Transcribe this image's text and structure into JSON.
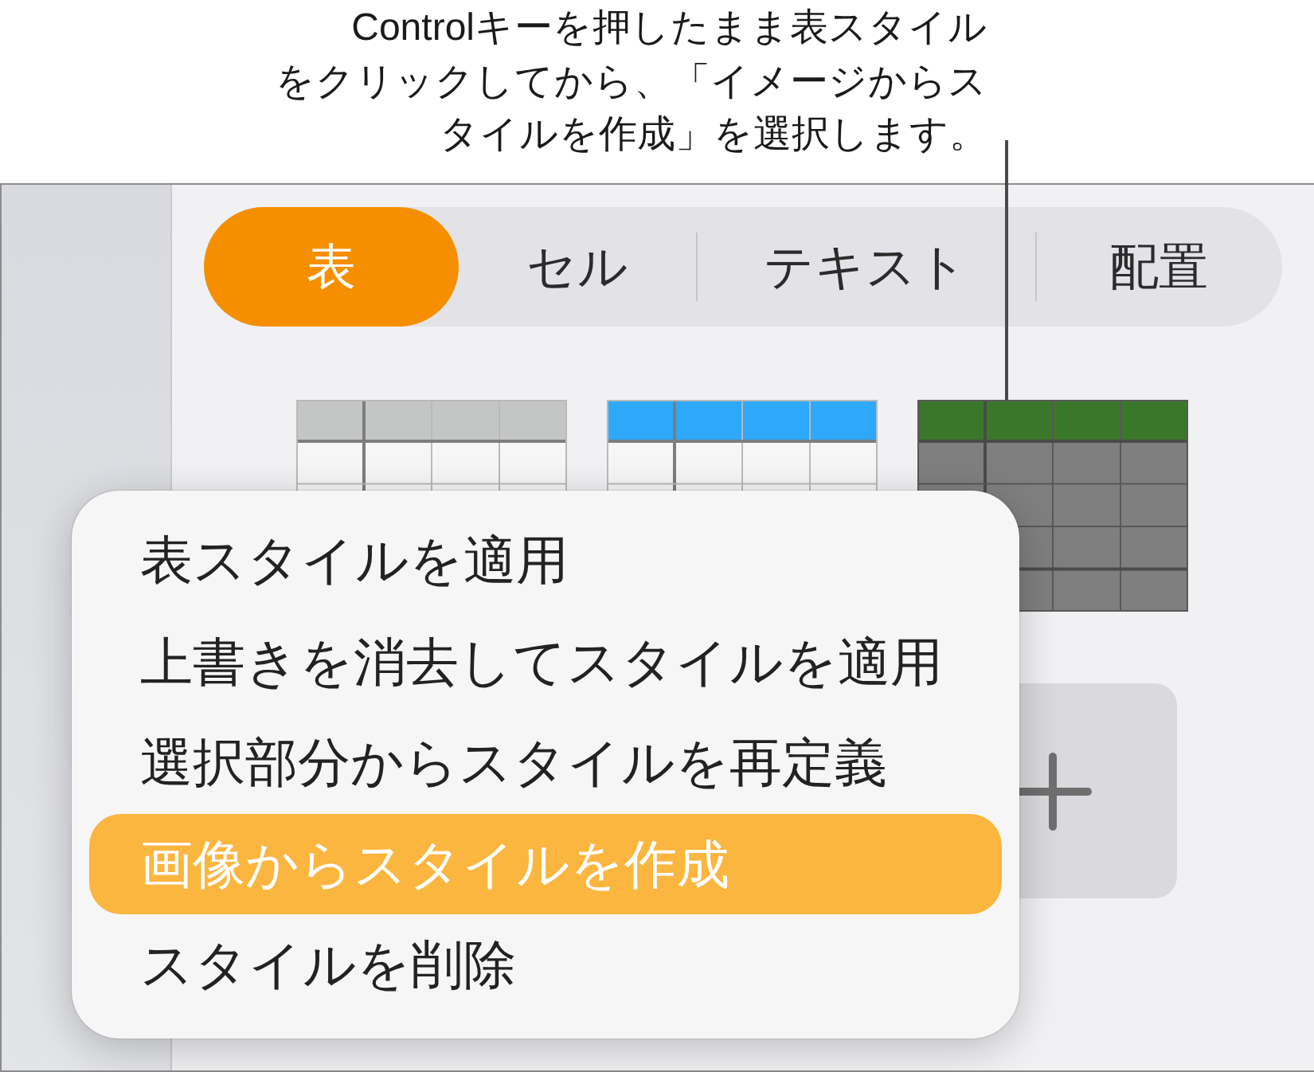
{
  "callout": {
    "lines": [
      "Controlキーを押したまま表スタイル",
      "をクリックしてから、「イメージからス",
      "タイルを作成」を選択します。"
    ]
  },
  "tabs": [
    {
      "label": "表",
      "selected": true
    },
    {
      "label": "セル",
      "selected": false
    },
    {
      "label": "テキスト",
      "selected": false
    },
    {
      "label": "配置",
      "selected": false
    }
  ],
  "table_styles": [
    {
      "color": "#c4c6c5",
      "kind": "light"
    },
    {
      "color": "#2ea8fb",
      "kind": "light"
    },
    {
      "color": "#3b772a",
      "kind": "dark"
    }
  ],
  "context_menu": {
    "items": [
      {
        "label": "表スタイルを適用",
        "selected": false
      },
      {
        "label": "上書きを消去してスタイルを適用",
        "selected": false
      },
      {
        "label": "選択部分からスタイルを再定義",
        "selected": false
      },
      {
        "label": "画像からスタイルを作成",
        "selected": true
      },
      {
        "label": "スタイルを削除",
        "selected": false
      }
    ]
  }
}
